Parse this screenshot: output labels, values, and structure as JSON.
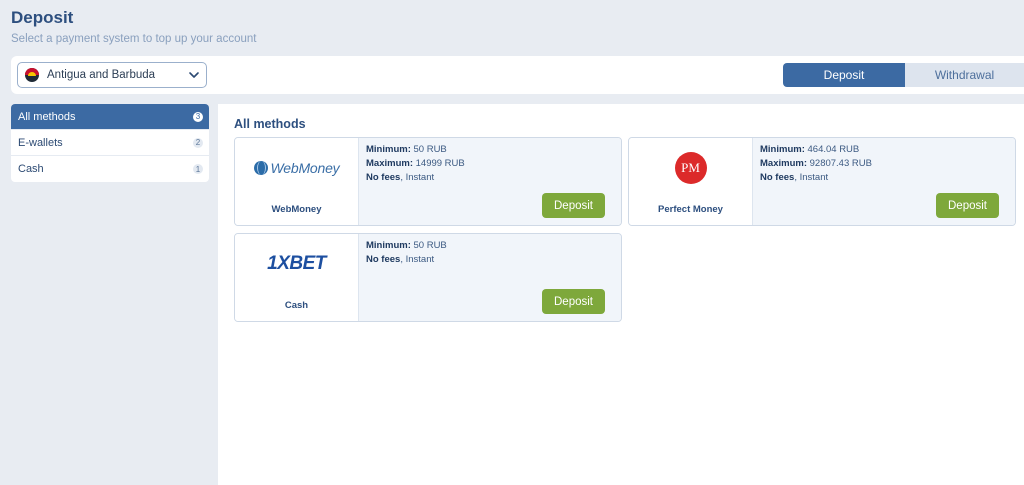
{
  "header": {
    "title": "Deposit",
    "subtitle": "Select a payment system to top up your account"
  },
  "country": {
    "selected": "Antigua and Barbuda"
  },
  "mode_toggle": {
    "deposit": "Deposit",
    "withdrawal": "Withdrawal",
    "active": "deposit"
  },
  "sidebar": {
    "items": [
      {
        "label": "All methods",
        "count": "3",
        "active": true
      },
      {
        "label": "E-wallets",
        "count": "2",
        "active": false
      },
      {
        "label": "Cash",
        "count": "1",
        "active": false
      }
    ]
  },
  "main": {
    "section_title": "All methods",
    "cards": [
      {
        "name": "WebMoney",
        "logo_text": "WebMoney",
        "min_label": "Minimum:",
        "min_value": " 50 RUB",
        "max_label": "Maximum:",
        "max_value": " 14999 RUB",
        "fees_label": "No fees",
        "fees_value": ", Instant",
        "button": "Deposit"
      },
      {
        "name": "Perfect Money",
        "logo_text": "PM",
        "min_label": "Minimum:",
        "min_value": " 464.04 RUB",
        "max_label": "Maximum:",
        "max_value": " 92807.43 RUB",
        "fees_label": "No fees",
        "fees_value": ", Instant",
        "button": "Deposit"
      },
      {
        "name": "Cash",
        "logo_text": "1XBET",
        "min_label": "Minimum:",
        "min_value": " 50 RUB",
        "fees_label": "No fees",
        "fees_value": ", Instant",
        "button": "Deposit"
      }
    ]
  },
  "colors": {
    "primary": "#3c6aa3",
    "deposit_button": "#7ea83b",
    "background": "#e8ecf2"
  }
}
